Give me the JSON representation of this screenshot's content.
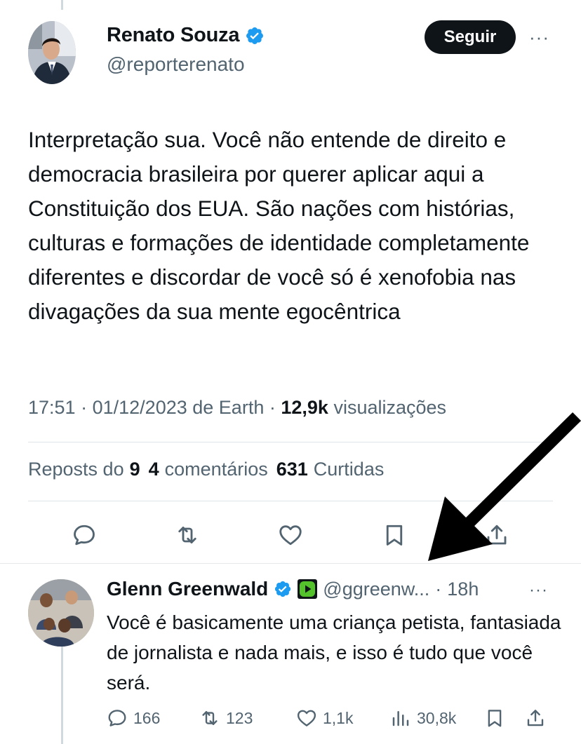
{
  "tweet": {
    "author": {
      "name": "Renato Souza",
      "handle": "@reporterenato",
      "verified": true
    },
    "follow_label": "Seguir",
    "more_label": "···",
    "text": "Interpretação sua. Você não entende de direito e democracia brasileira por querer aplicar aqui a Constituição dos EUA. São nações com histórias, culturas e formações de identidade completamente diferentes e discordar de você só é xenofobia nas divagações da sua mente egocêntrica",
    "meta": {
      "time": "17:51",
      "sep1": "·",
      "date": "01/12/2023",
      "source": "de Earth",
      "sep2": "·",
      "views_count": "12,9k",
      "views_label": "visualizações"
    },
    "stats": {
      "reposts_label": "Reposts do",
      "reposts_count": "9",
      "comments_count": "4",
      "comments_label": "comentários",
      "likes_count": "631",
      "likes_label": "Curtidas"
    }
  },
  "reply": {
    "author": {
      "name": "Glenn Greenwald",
      "handle": "@ggreenw...",
      "verified": true
    },
    "sep": "·",
    "time": "18h",
    "more_label": "···",
    "text": "Você é basicamente uma criança petista, fantasiada de jornalista e nada mais, e isso é tudo que você será.",
    "actions": {
      "replies": "166",
      "reposts": "123",
      "likes": "1,1k",
      "views": "30,8k"
    }
  },
  "colors": {
    "text": "#0f1419",
    "secondary": "#536471",
    "verified": "#1d9bf0",
    "divider": "#dfe4e8",
    "badge": "#53c22b"
  },
  "icons": [
    "reply-icon",
    "repost-icon",
    "like-icon",
    "bookmark-icon",
    "share-icon",
    "views-icon",
    "verified-badge-icon",
    "rumble-badge-icon",
    "annotation-arrow"
  ]
}
